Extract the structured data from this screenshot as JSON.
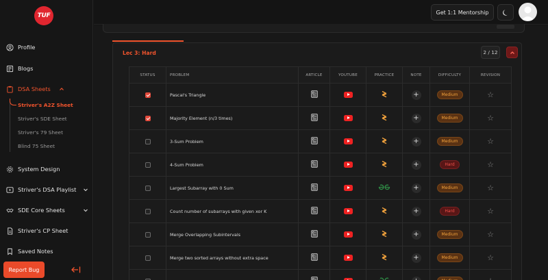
{
  "brand": {
    "logo_text": "TUF",
    "accent": "#e0262f"
  },
  "sidebar": {
    "items": [
      {
        "label": "Profile",
        "icon": "user-circle-icon"
      },
      {
        "label": "Blogs",
        "icon": "blog-icon"
      },
      {
        "label": "DSA Sheets",
        "icon": "clipboard-icon",
        "expanded": true
      },
      {
        "label": "System Design",
        "icon": "gear-icon"
      },
      {
        "label": "Striver's DSA Playlist",
        "icon": "play-icon"
      },
      {
        "label": "SDE Core Sheets",
        "icon": "handshake-icon"
      },
      {
        "label": "Striver's CP Sheet",
        "icon": "document-icon"
      },
      {
        "label": "Saved Notes",
        "icon": "bookmark-icon"
      }
    ],
    "subitems": [
      {
        "label": "Striver's A2Z Sheet",
        "active": true
      },
      {
        "label": "Striver's SDE Sheet"
      },
      {
        "label": "Striver's 79 Sheet"
      },
      {
        "label": "Blind 75 Sheet"
      }
    ],
    "report_bug": "Report Bug"
  },
  "header": {
    "mentorship_label": "Get 1:1 Mentorship"
  },
  "section": {
    "title": "Lec 3: Hard",
    "counter": "2 / 12"
  },
  "table": {
    "columns": [
      "STATUS",
      "PROBLEM",
      "ARTICLE",
      "YOUTUBE",
      "PRACTICE",
      "NOTE",
      "DIFFICULTY",
      "REVISION"
    ],
    "rows": [
      {
        "checked": true,
        "problem": "Pascal's Triangle",
        "practice": "codestudio",
        "difficulty": "Medium"
      },
      {
        "checked": true,
        "problem": "Majority Element (n/3 times)",
        "practice": "codestudio",
        "difficulty": "Medium"
      },
      {
        "checked": false,
        "problem": "3-Sum Problem",
        "practice": "codestudio",
        "difficulty": "Medium"
      },
      {
        "checked": false,
        "problem": "4-Sum Problem",
        "practice": "codestudio",
        "difficulty": "Hard"
      },
      {
        "checked": false,
        "problem": "Largest Subarray with 0 Sum",
        "practice": "gfg",
        "difficulty": "Medium"
      },
      {
        "checked": false,
        "problem": "Count number of subarrays with given xor K",
        "practice": "codestudio",
        "difficulty": "Hard"
      },
      {
        "checked": false,
        "problem": "Merge Overlapping Subintervals",
        "practice": "codestudio",
        "difficulty": "Medium"
      },
      {
        "checked": false,
        "problem": "Merge two sorted arrays without extra space",
        "practice": "codestudio",
        "difficulty": "Medium"
      },
      {
        "checked": false,
        "problem": "",
        "practice": "gfg",
        "difficulty": "Medium"
      }
    ]
  },
  "colors": {
    "accent": "#f2542d",
    "medium": "#f2a23c",
    "hard": "#f0524a",
    "youtube": "#ee2222",
    "gfg": "#2f8d46"
  }
}
